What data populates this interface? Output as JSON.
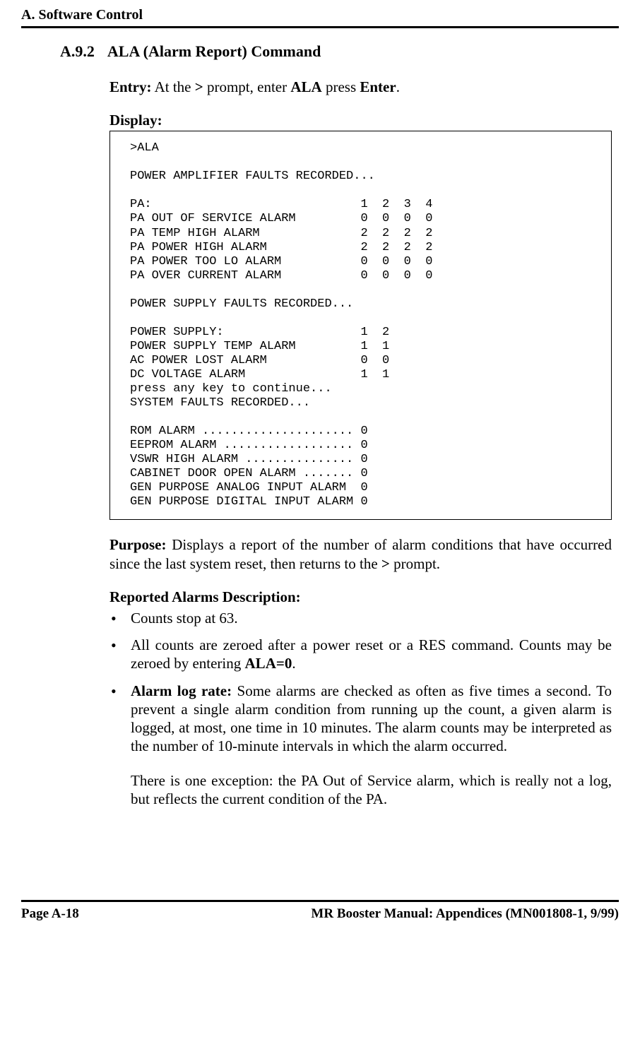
{
  "header": {
    "running_title": "A. Software Control"
  },
  "section": {
    "number": "A.9.2",
    "title": "ALA (Alarm Report) Command"
  },
  "entry": {
    "label": "Entry:",
    "before_prompt": "  At the ",
    "prompt_char": ">",
    "after_prompt": " prompt, enter ",
    "cmd": "ALA",
    "mid": " press ",
    "keyname": "Enter",
    "end": "."
  },
  "display_label": "Display:",
  "display_text": ">ALA\n\nPOWER AMPLIFIER FAULTS RECORDED...\n\nPA:                             1  2  3  4\nPA OUT OF SERVICE ALARM         0  0  0  0\nPA TEMP HIGH ALARM              2  2  2  2\nPA POWER HIGH ALARM             2  2  2  2\nPA POWER TOO LO ALARM           0  0  0  0\nPA OVER CURRENT ALARM           0  0  0  0\n\nPOWER SUPPLY FAULTS RECORDED...\n\nPOWER SUPPLY:                   1  2\nPOWER SUPPLY TEMP ALARM         1  1\nAC POWER LOST ALARM             0  0\nDC VOLTAGE ALARM                1  1\npress any key to continue...\nSYSTEM FAULTS RECORDED...\n\nROM ALARM ..................... 0\nEEPROM ALARM .................. 0\nVSWR HIGH ALARM ............... 0\nCABINET DOOR OPEN ALARM ....... 0\nGEN PURPOSE ANALOG INPUT ALARM  0\nGEN PURPOSE DIGITAL INPUT ALARM 0\n",
  "purpose": {
    "label": "Purpose:",
    "text": "  Displays a report of the number of alarm conditions that have occurred since the last system reset, then returns to the ",
    "prompt_char": ">",
    "tail": " prompt."
  },
  "reported": {
    "heading": "Reported Alarms Description:",
    "bullets": [
      {
        "plain": "Counts stop at 63."
      },
      {
        "pre": "All counts are zeroed after a power reset or a RES command. Counts may be zeroed by entering ",
        "bold": "ALA=0",
        "post": "."
      },
      {
        "bold_lead": "Alarm log rate:",
        "rest": " Some alarms are checked as often as five times a second. To prevent a single alarm condition from running up the count, a given alarm is logged, at most, one time in 10 minutes. The alarm counts may be interpreted as the number of 10-minute intervals in which the alarm occurred."
      }
    ],
    "exception": "There is one exception: the PA Out of Service alarm, which is really not a log, but reflects the current condition of the PA."
  },
  "footer": {
    "left": "Page A-18",
    "right": "MR Booster Manual: Appendices (MN001808-1, 9/99)"
  }
}
